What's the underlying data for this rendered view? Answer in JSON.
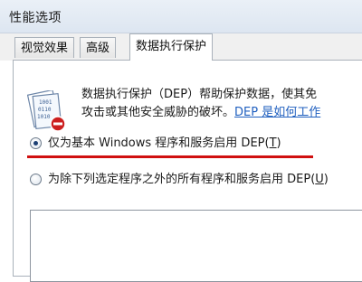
{
  "window": {
    "title": "性能选项"
  },
  "tabs": [
    {
      "label": "视觉效果",
      "active": false
    },
    {
      "label": "高级",
      "active": false
    },
    {
      "label": "数据执行保护",
      "active": true
    }
  ],
  "description": {
    "line1": "数据执行保护（DEP）帮助保护数据，使其免",
    "line2": "攻击或其他安全威胁的破坏。",
    "link": "DEP 是如何工作"
  },
  "options": [
    {
      "label": "仅为基本 Windows 程序和服务启用 DEP(",
      "accel": "T",
      "suffix": ")",
      "checked": true
    },
    {
      "label": "为除下列选定程序之外的所有程序和服务启用 DEP(",
      "accel": "U",
      "suffix": ")",
      "checked": false
    }
  ],
  "icon": {
    "name": "dep-shield-icon",
    "binary_rows": [
      "1001",
      "0110",
      "1010"
    ]
  },
  "colors": {
    "highlight_underline": "#d01010",
    "link": "#1f5fbf"
  }
}
